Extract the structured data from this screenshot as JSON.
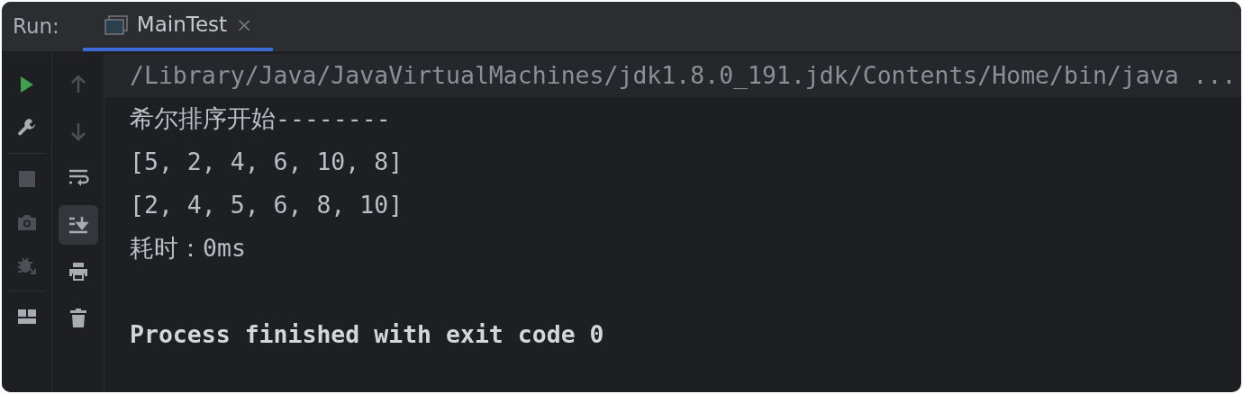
{
  "panel": {
    "label": "Run:"
  },
  "tabs": [
    {
      "label": "MainTest",
      "selected": true,
      "close": "×"
    }
  ],
  "left_toolbar": [
    {
      "kind": "run",
      "disabled": false
    },
    {
      "kind": "settings",
      "disabled": false
    },
    {
      "kind": "stop",
      "disabled": true
    },
    {
      "kind": "camera",
      "disabled": true
    },
    {
      "kind": "bug",
      "disabled": true
    },
    {
      "kind": "layout",
      "disabled": false
    }
  ],
  "right_toolbar": [
    {
      "kind": "up",
      "disabled": true,
      "selected": false
    },
    {
      "kind": "down",
      "disabled": true,
      "selected": false
    },
    {
      "kind": "wrap",
      "disabled": false,
      "selected": false
    },
    {
      "kind": "scroll-end",
      "disabled": false,
      "selected": true
    },
    {
      "kind": "print",
      "disabled": false,
      "selected": false
    },
    {
      "kind": "trash",
      "disabled": false,
      "selected": false
    }
  ],
  "console": {
    "lines": [
      {
        "kind": "command",
        "text": "/Library/Java/JavaVirtualMachines/jdk1.8.0_191.jdk/Contents/Home/bin/java ..."
      },
      {
        "kind": "output",
        "text": "希尔排序开始--------"
      },
      {
        "kind": "output",
        "text": "[5, 2, 4, 6, 10, 8]"
      },
      {
        "kind": "output",
        "text": "[2, 4, 5, 6, 8, 10]"
      },
      {
        "kind": "output",
        "text": "耗时：0ms"
      },
      {
        "kind": "blank"
      },
      {
        "kind": "system",
        "text": "Process finished with exit code 0"
      }
    ]
  }
}
